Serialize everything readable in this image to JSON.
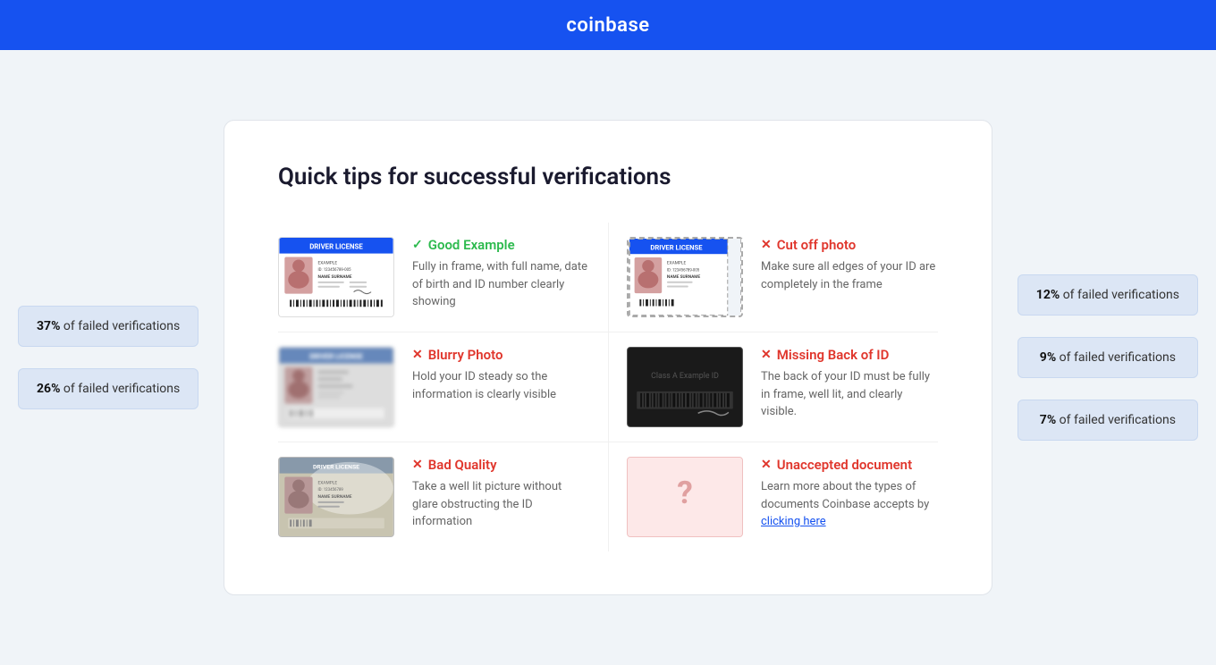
{
  "header": {
    "logo": "coinbase"
  },
  "page": {
    "title": "Quick tips for successful verifications"
  },
  "left_badges": [
    {
      "percent": "37%",
      "label": "of failed verifications"
    },
    {
      "percent": "26%",
      "label": "of failed verifications"
    }
  ],
  "right_badges": [
    {
      "percent": "12%",
      "label": "of failed verifications"
    },
    {
      "percent": "9%",
      "label": "of failed verifications"
    },
    {
      "percent": "7%",
      "label": "of failed verifications"
    }
  ],
  "tips": [
    {
      "id": "good-example",
      "type": "good",
      "icon": "✓",
      "label": "Good Example",
      "desc": "Fully in frame, with full name, date of birth and ID number clearly showing",
      "card_type": "id-good"
    },
    {
      "id": "cut-off-photo",
      "type": "bad",
      "icon": "✕",
      "label": "Cut off photo",
      "desc": "Make sure all edges of your ID are completely in the frame",
      "card_type": "id-cutoff"
    },
    {
      "id": "blurry-photo",
      "type": "bad",
      "icon": "✕",
      "label": "Blurry Photo",
      "desc": "Hold your ID steady so the information is clearly visible",
      "card_type": "id-blurry"
    },
    {
      "id": "missing-back-of-id",
      "type": "bad",
      "icon": "✕",
      "label": "Missing Back of ID",
      "desc": "The back of your ID must be fully in frame, well lit, and clearly visible.",
      "card_type": "id-missingback"
    },
    {
      "id": "bad-quality",
      "type": "bad",
      "icon": "✕",
      "label": "Bad Quality",
      "desc": "Take a well lit picture without glare obstructing the ID information",
      "card_type": "id-badquality"
    },
    {
      "id": "unaccepted-document",
      "type": "bad",
      "icon": "✕",
      "label": "Unaccepted document",
      "desc": "Learn more about the types of documents Coinbase accepts by",
      "link_text": "clicking here",
      "card_type": "id-unaccepted"
    }
  ],
  "colors": {
    "header_bg": "#1652f0",
    "good": "#2dba4e",
    "bad": "#e0362c",
    "page_bg": "#f0f4f8"
  }
}
